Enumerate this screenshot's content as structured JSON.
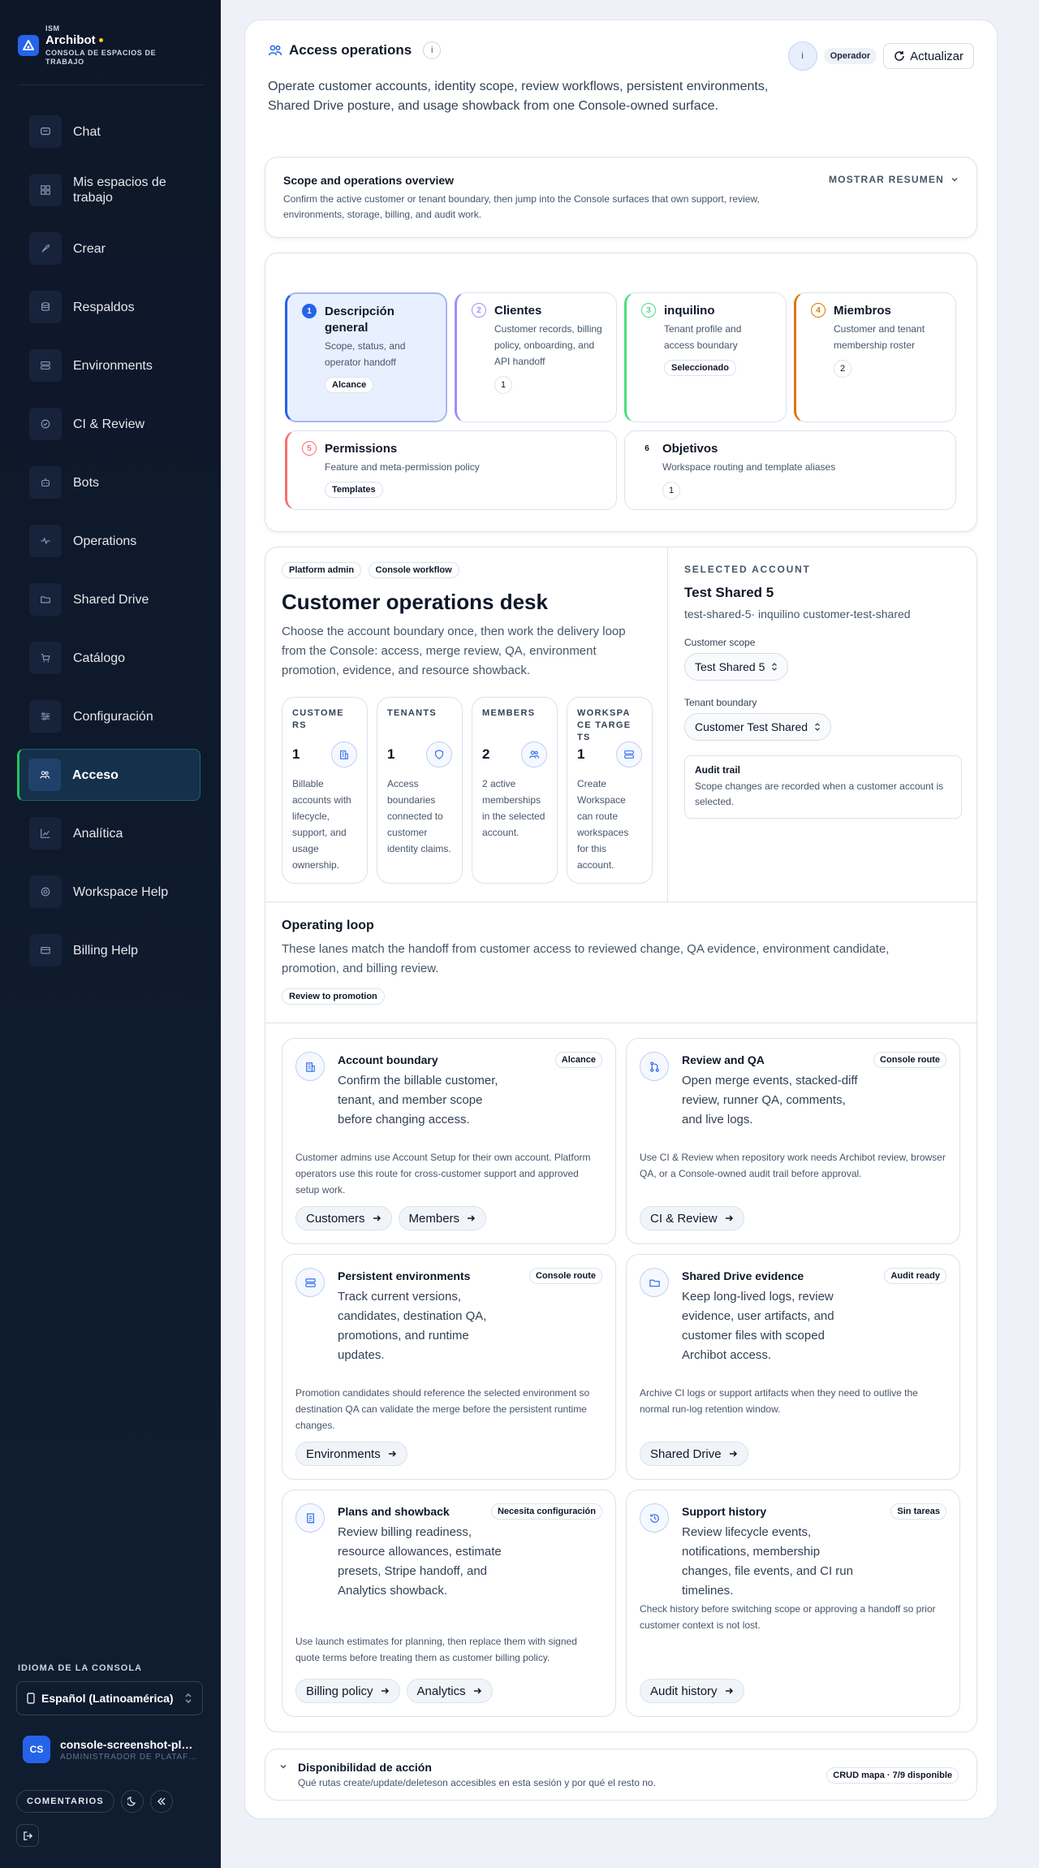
{
  "brand": {
    "org": "ISM",
    "name": "Archibot",
    "subtitle": "CONSOLA DE ESPACIOS DE TRABAJO"
  },
  "sidebar": {
    "items": [
      {
        "label": "Chat",
        "icon": "chat-icon"
      },
      {
        "label": "Mis espacios de trabajo",
        "icon": "grid-icon"
      },
      {
        "label": "Crear",
        "icon": "rocket-icon"
      },
      {
        "label": "Respaldos",
        "icon": "database-icon"
      },
      {
        "label": "Environments",
        "icon": "server-icon"
      },
      {
        "label": "CI & Review",
        "icon": "check-circle-icon"
      },
      {
        "label": "Bots",
        "icon": "bot-icon"
      },
      {
        "label": "Operations",
        "icon": "pulse-icon"
      },
      {
        "label": "Shared Drive",
        "icon": "folder-icon"
      },
      {
        "label": "Catálogo",
        "icon": "cart-icon"
      },
      {
        "label": "Configuración",
        "icon": "sliders-icon"
      },
      {
        "label": "Acceso",
        "icon": "users-icon",
        "active": true
      },
      {
        "label": "Analítica",
        "icon": "chart-icon"
      },
      {
        "label": "Workspace Help",
        "icon": "lifebuoy-icon"
      },
      {
        "label": "Billing Help",
        "icon": "card-icon"
      }
    ],
    "language_title": "IDIOMA DE LA CONSOLA",
    "language_value": "Español (Latinoamérica)",
    "user_initials": "CS",
    "user_name": "console-screenshot-platform",
    "user_role": "ADMINISTRADOR DE PLATAFORMA",
    "feedback_label": "COMENTARIOS"
  },
  "header": {
    "title": "Access operations",
    "info_label": "i",
    "operator_initial": "i",
    "operator_badge": "Operador",
    "refresh_label": "Actualizar",
    "intro": "Operate customer accounts, identity scope, review workflows, persistent environments, Shared Drive posture, and usage showback from one Console-owned surface."
  },
  "scope": {
    "title": "Scope and operations overview",
    "description": "Confirm the active customer or tenant boundary, then jump into the Console surfaces that own support, review, environments, storage, billing, and audit work.",
    "toggle_label": "MOSTRAR RESUMEN"
  },
  "steps": [
    {
      "num": "1",
      "title": "Descripción general",
      "desc": "Scope, status, and operator handoff",
      "tag": "Alcance",
      "color": "#2563eb"
    },
    {
      "num": "2",
      "title": "Clientes",
      "desc": "Customer records, billing policy, onboarding, and API handoff",
      "count": "1",
      "color": "#a78bfa"
    },
    {
      "num": "3",
      "title": "inquilino",
      "desc": "Tenant profile and access boundary",
      "tag": "Seleccionado",
      "color": "#4ade80"
    },
    {
      "num": "4",
      "title": "Miembros",
      "desc": "Customer and tenant membership roster",
      "count": "2",
      "color": "#d97706"
    },
    {
      "num": "5",
      "title": "Permissions",
      "desc": "Feature and meta-permission policy",
      "tag": "Templates",
      "color": "#f87171"
    },
    {
      "num": "6",
      "title": "Objetivos",
      "desc": "Workspace routing and template aliases",
      "count": "1",
      "color": "#cbd5e1"
    }
  ],
  "desk": {
    "chips": [
      "Platform admin",
      "Console workflow"
    ],
    "title": "Customer operations desk",
    "description": "Choose the account boundary once, then work the delivery loop from the Console: access, merge review, QA, environment promotion, evidence, and resource showback.",
    "metrics": [
      {
        "label": "CUSTOMERS",
        "value": "1",
        "icon": "building-icon",
        "desc": "Billable accounts with lifecycle, support, and usage ownership."
      },
      {
        "label": "TENANTS",
        "value": "1",
        "icon": "shield-icon",
        "desc": "Access boundaries connected to customer identity claims."
      },
      {
        "label": "MEMBERS",
        "value": "2",
        "icon": "users-icon",
        "desc": "2 active memberships in the selected account."
      },
      {
        "label": "WORKSPACE TARGETS",
        "value": "1",
        "icon": "server-icon",
        "desc": "Create Workspace can route workspaces for this account."
      }
    ],
    "selected": {
      "label": "SELECTED ACCOUNT",
      "name": "Test Shared 5",
      "sub": "test-shared-5· inquilino customer-test-shared",
      "customer_scope_label": "Customer scope",
      "customer_scope_value": "Test Shared 5",
      "tenant_label": "Tenant boundary",
      "tenant_value": "Customer Test Shared",
      "audit_title": "Audit trail",
      "audit_desc": "Scope changes are recorded when a customer account is selected."
    }
  },
  "loop": {
    "title": "Operating loop",
    "description": "These lanes match the handoff from customer access to reviewed change, QA evidence, environment candidate, promotion, and billing review.",
    "chip": "Review to promotion"
  },
  "lanes": [
    {
      "title": "Account boundary",
      "badge": "Alcance",
      "icon": "building-icon",
      "desc": "Confirm the billable customer, tenant, and member scope before changing access.",
      "note": "Customer admins use Account Setup for their own account. Platform operators use this route for cross-customer support and approved setup work.",
      "actions": [
        "Customers",
        "Members"
      ]
    },
    {
      "title": "Review and QA",
      "badge": "Console route",
      "icon": "git-merge-icon",
      "desc": "Open merge events, stacked-diff review, runner QA, comments, and live logs.",
      "note": "Use CI & Review when repository work needs Archibot review, browser QA, or a Console-owned audit trail before approval.",
      "actions": [
        "CI & Review"
      ]
    },
    {
      "title": "Persistent environments",
      "badge": "Console route",
      "icon": "server-icon",
      "desc": "Track current versions, candidates, destination QA, promotions, and runtime updates.",
      "note": "Promotion candidates should reference the selected environment so destination QA can validate the merge before the persistent runtime changes.",
      "actions": [
        "Environments"
      ]
    },
    {
      "title": "Shared Drive evidence",
      "badge": "Audit ready",
      "icon": "folder-icon",
      "desc": "Keep long-lived logs, review evidence, user artifacts, and customer files with scoped Archibot access.",
      "note": "Archive CI logs or support artifacts when they need to outlive the normal run-log retention window.",
      "actions": [
        "Shared Drive"
      ]
    },
    {
      "title": "Plans and showback",
      "badge": "Necesita configuración",
      "icon": "receipt-icon",
      "desc": "Review billing readiness, resource allowances, estimate presets, Stripe handoff, and Analytics showback.",
      "note": "Use launch estimates for planning, then replace them with signed quote terms before treating them as customer billing policy.",
      "actions": [
        "Billing policy",
        "Analytics"
      ]
    },
    {
      "title": "Support history",
      "badge": "Sin tareas",
      "icon": "history-icon",
      "desc": "Review lifecycle events, notifications, membership changes, file events, and CI run timelines.",
      "note": "Check history before switching scope or approving a handoff so prior customer context is not lost.",
      "actions": [
        "Audit history"
      ]
    }
  ],
  "availability": {
    "title": "Disponibilidad de acción",
    "description": "Qué rutas create/update/deleteson accesibles en esta sesión y por qué el resto no.",
    "badge": "CRUD mapa · 7/9 disponible"
  }
}
